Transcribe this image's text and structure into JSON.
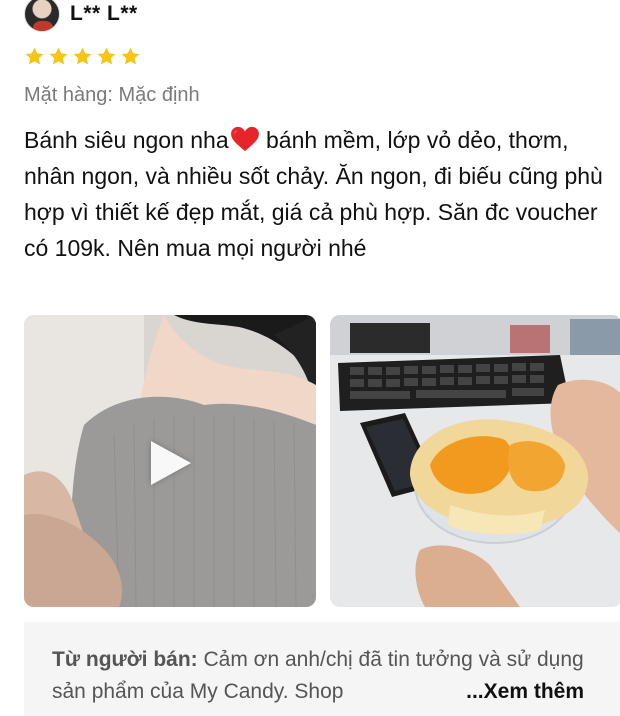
{
  "reviewer": {
    "name": "L** L**",
    "avatar_icon": "user-avatar-icon"
  },
  "rating": {
    "stars": 5,
    "max": 5,
    "color": "#F5C518"
  },
  "variant_text": "Mặt hàng: Mặc định",
  "review": {
    "before_heart": "Bánh siêu ngon nha",
    "heart_icon": "red-heart-emoji",
    "after_heart": " bánh mềm, lớp vỏ dẻo, thơm, nhân ngon, và nhiều sốt chảy. Ăn ngon, đi biếu cũng phù hợp vì thiết kế đẹp mắt, giá cả phù hợp. Săn đc voucher có 109k. Nên mua mọi người nhé"
  },
  "media": [
    {
      "type": "video",
      "icon": "play-icon"
    },
    {
      "type": "photo"
    }
  ],
  "seller_reply": {
    "label": "Từ người bán:",
    "text": " Cảm ơn anh/chị đã tin tưởng và sử dụng sản phẩm của My Candy. Shop ",
    "more": "...Xem thêm"
  }
}
